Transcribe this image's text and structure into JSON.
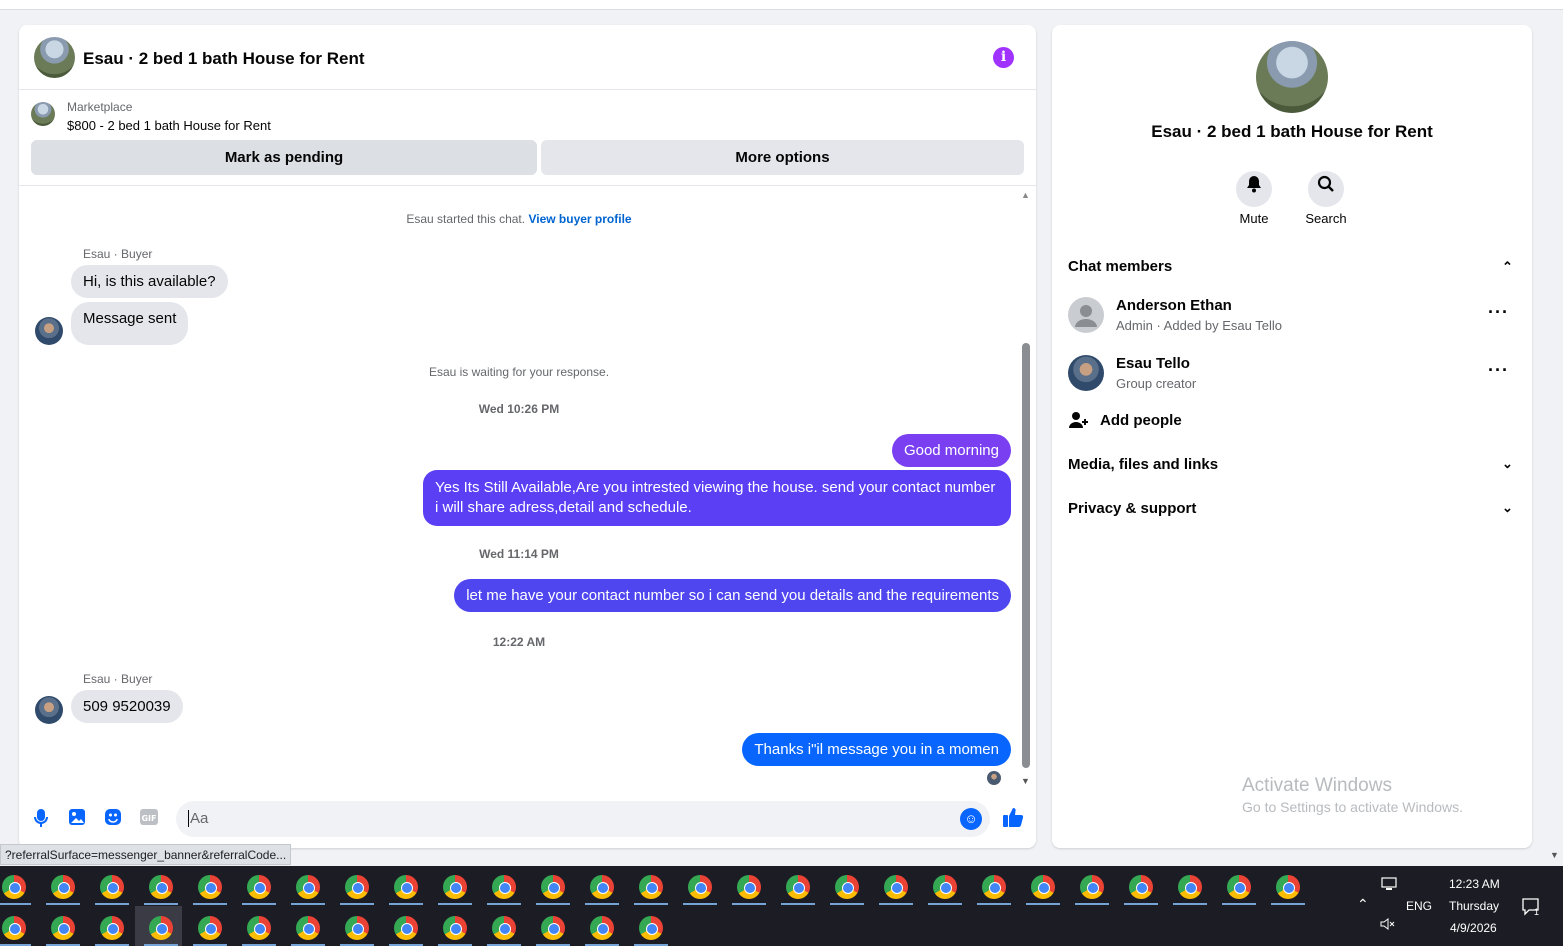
{
  "chat": {
    "title": "Esau · 2 bed 1 bath House for Rent",
    "listing_label": "Marketplace",
    "listing_title": "$800 - 2 bed 1 bath House for Rent",
    "btn_pending": "Mark as pending",
    "btn_more": "More options",
    "started_text": "Esau started this chat.",
    "view_profile": "View buyer profile",
    "sender1": "Esau · Buyer",
    "msg_in_1": "Hi, is this available?",
    "msg_in_2": "Message sent",
    "waiting": "Esau is waiting for your response.",
    "stamp1": "Wed 10:26 PM",
    "msg_out_1": "Good morning",
    "msg_out_2": "Yes Its Still Available,Are you intrested viewing the house. send your contact number i will share adress,detail and schedule.",
    "stamp2": "Wed 11:14 PM",
    "msg_out_3": "let me have your contact number so i can send you details and the requirements",
    "stamp3": "12:22 AM",
    "sender2": "Esau · Buyer",
    "msg_in_3": "509 9520039",
    "msg_out_4": "Thanks i\"il message you in a momen",
    "composer_placeholder": "Aa",
    "colors": {
      "out_purple": "#7b3ff2",
      "out_violet": "#5b3ff5",
      "out_blue": "#4f46f0",
      "out_last": "#0866ff"
    }
  },
  "side": {
    "title": "Esau · 2 bed 1 bath House for Rent",
    "mute": "Mute",
    "search": "Search",
    "members_head": "Chat members",
    "members": [
      {
        "name": "Anderson Ethan",
        "sub": "Admin · Added by Esau Tello"
      },
      {
        "name": "Esau Tello",
        "sub": "Group creator"
      }
    ],
    "add_people": "Add people",
    "media_head": "Media, files and links",
    "privacy_head": "Privacy & support",
    "activate_title": "Activate Windows",
    "activate_sub": "Go to Settings to activate Windows."
  },
  "status_url": "?referralSurface=messenger_banner&referralCode...",
  "taskbar": {
    "time": "12:23 AM",
    "day": "Thursday",
    "date": "4/9/2026",
    "lang": "ENG",
    "notif_count": "1"
  }
}
